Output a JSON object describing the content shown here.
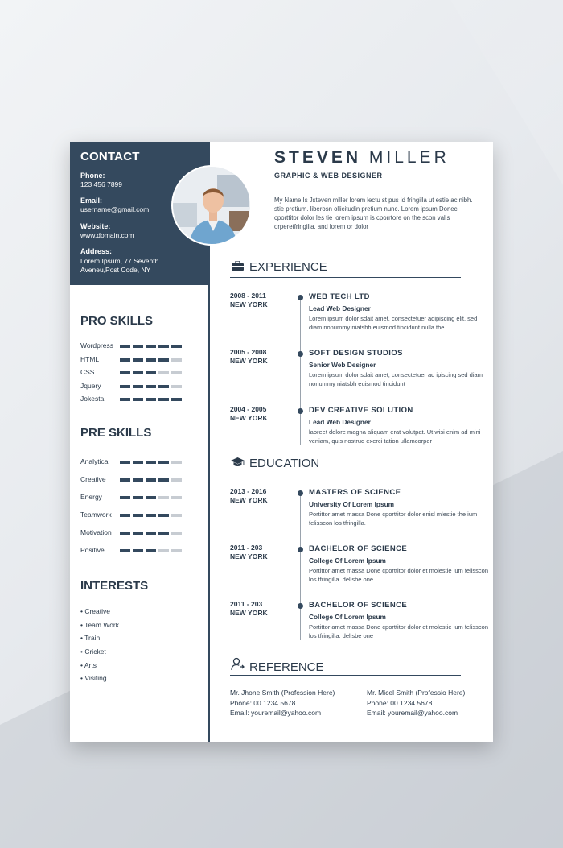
{
  "contact": {
    "title": "CONTACT",
    "phone_label": "Phone:",
    "phone": "123 456 7899",
    "email_label": "Email:",
    "email": "username@gmail.com",
    "website_label": "Website:",
    "website": "www.domain.com",
    "address_label": "Address:",
    "address": "Lorem Ipsum, 77 Seventh Aveneu,Post Code, NY"
  },
  "pro_skills": {
    "title": "PRO SKILLS",
    "items": [
      {
        "name": "Wordpress",
        "level": 5
      },
      {
        "name": "HTML",
        "level": 4
      },
      {
        "name": "CSS",
        "level": 3
      },
      {
        "name": "Jquery",
        "level": 4
      },
      {
        "name": "Jokesta",
        "level": 5
      }
    ]
  },
  "pre_skills": {
    "title": "PRE SKILLS",
    "items": [
      {
        "name": "Analytical",
        "level": 4
      },
      {
        "name": "Creative",
        "level": 4
      },
      {
        "name": "Energy",
        "level": 3
      },
      {
        "name": "Teamwork",
        "level": 4
      },
      {
        "name": "Motivation",
        "level": 4
      },
      {
        "name": "Positive",
        "level": 3
      }
    ]
  },
  "interests": {
    "title": "INTERESTS",
    "items": [
      "• Creative",
      "• Team Work",
      "• Train",
      "• Cricket",
      "• Arts",
      "• Visiting"
    ]
  },
  "header": {
    "first_name": "STEVEN",
    "last_name": "MILLER",
    "role": "GRAPHIC & WEB DESIGNER",
    "intro": "My Name Is Jsteven miller lorem lectu st pus id fringilla ut estie ac nibh. stie pretium. liberosn ollicitudin pretium nunc. Lorem ipsum Donec cporttitor dolor les tie lorem ipsum is cporrtore on the scon valls orperetfringilla. and lorem or dolor"
  },
  "experience": {
    "title": "EXPERIENCE",
    "entries": [
      {
        "years": "2008 - 2011",
        "place": "NEW YORK",
        "title": "WEB TECH LTD",
        "subtitle": "Lead Web Designer",
        "desc": "Lorem ipsum dolor sdait amet, consectetuer adipiscing elit, sed diam nonummy niatsbh euismod tincidunt nulla the"
      },
      {
        "years": "2005 - 2008",
        "place": "NEW YORK",
        "title": "SOFT DESIGN STUDIOS",
        "subtitle": "Senior Web Designer",
        "desc": "Lorem ipsum dolor sdait amet, consectetuer ad ipiscing sed diam nonummy niatsbh euismod tincidunt"
      },
      {
        "years": "2004 - 2005",
        "place": "NEW YORK",
        "title": "DEV CREATIVE SOLUTION",
        "subtitle": "Lead Web Designer",
        "desc": "laoreet dolore magna aliquam erat volutpat. Ut wisi enim ad mini veniam, quis nostrud exerci tation ullamcorper"
      }
    ]
  },
  "education": {
    "title": "EDUCATION",
    "entries": [
      {
        "years": "2013 - 2016",
        "place": "NEW YORK",
        "title": "MASTERS OF SCIENCE",
        "subtitle": "University Of Lorem Ipsum",
        "desc": "Portittor amet massa Done cporttitor dolor enisl mlestie the ium felisscon los tfringilla."
      },
      {
        "years": "2011 - 203",
        "place": "NEW YORK",
        "title": "BACHELOR OF SCIENCE",
        "subtitle": "College Of Lorem Ipsum",
        "desc": "Portittor amet massa Done cporttitor dolor et molestie ium felisscon los tfringilla. delisbe one"
      },
      {
        "years": "2011 - 203",
        "place": "NEW YORK",
        "title": "BACHELOR OF SCIENCE",
        "subtitle": "College Of Lorem Ipsum",
        "desc": "Portittor amet massa Done cporttitor dolor et molestie ium felisscon los tfringilla. delisbe one"
      }
    ]
  },
  "reference": {
    "title": "REFERENCE",
    "people": [
      {
        "name": "Mr. Jhone Smith (Profession Here)",
        "phone": "Phone: 00 1234 5678",
        "email": "Email: youremail@yahoo.com"
      },
      {
        "name": "Mr. Micel Smith (Professio Here)",
        "phone": "Phone: 00 1234 5678",
        "email": "Email: youremail@yahoo.com"
      }
    ]
  },
  "colors": {
    "accent": "#34495e",
    "bar_off": "#c7ccd2"
  }
}
